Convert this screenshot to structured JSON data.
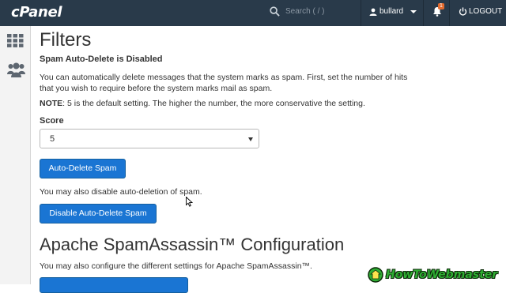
{
  "header": {
    "logo": "cPanel",
    "search_placeholder": "Search ( / )",
    "username": "bullard",
    "notification_count": "1",
    "logout_label": "LOGOUT"
  },
  "sidebar": {
    "items": [
      {
        "icon": "grid-icon"
      },
      {
        "icon": "users-icon"
      }
    ]
  },
  "main": {
    "title": "Filters",
    "status": "Spam Auto-Delete is Disabled",
    "description": "You can automatically delete messages that the system marks as spam. First, set the number of hits that you wish to require before the system marks mail as spam.",
    "note_label": "NOTE",
    "note_text": ": 5 is the default setting. The higher the number, the more conservative the setting.",
    "score_label": "Score",
    "score_value": "5",
    "auto_delete_button": "Auto-Delete Spam",
    "disable_text": "You may also disable auto-deletion of spam.",
    "disable_button": "Disable Auto-Delete Spam",
    "spamassassin_title": "Apache SpamAssassin™ Configuration",
    "spamassassin_text": "You may also configure the different settings for Apache SpamAssassin™."
  },
  "watermark": {
    "text": "HowToWebmaster"
  },
  "colors": {
    "topbar": "#293a4a",
    "button": "#1a75d3",
    "badge": "#e46b2e"
  }
}
